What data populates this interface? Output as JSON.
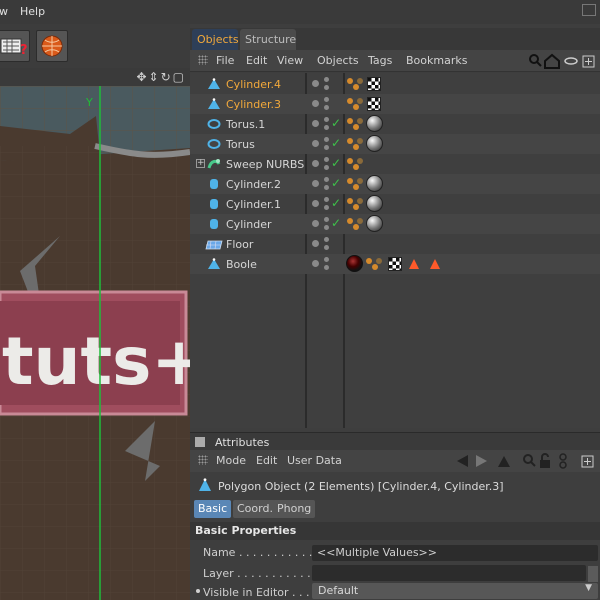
{
  "menubar": {
    "view_partial": "w",
    "help": "Help"
  },
  "objects_panel": {
    "tabs": [
      {
        "label": "Objects"
      },
      {
        "label": "Structure"
      }
    ],
    "menu": [
      "File",
      "Edit",
      "View",
      "Objects",
      "Tags",
      "Bookmarks"
    ],
    "objects": [
      {
        "name": "Cylinder.4",
        "selected": true,
        "icon": "polygon-object-icon"
      },
      {
        "name": "Cylinder.3",
        "selected": true,
        "icon": "polygon-object-icon"
      },
      {
        "name": "Torus.1",
        "icon": "torus-icon"
      },
      {
        "name": "Torus",
        "icon": "torus-icon"
      },
      {
        "name": "Sweep NURBS",
        "icon": "sweep-nurbs-icon"
      },
      {
        "name": "Cylinder.2",
        "icon": "cylinder-icon"
      },
      {
        "name": "Cylinder.1",
        "icon": "cylinder-icon"
      },
      {
        "name": "Cylinder",
        "icon": "cylinder-icon"
      },
      {
        "name": "Floor",
        "icon": "floor-icon"
      },
      {
        "name": "Boole",
        "icon": "boole-icon"
      }
    ]
  },
  "attributes": {
    "title": "Attributes",
    "menu": [
      "Mode",
      "Edit",
      "User Data"
    ],
    "object_title": "Polygon Object (2 Elements) [Cylinder.4, Cylinder.3]",
    "tabs": [
      "Basic",
      "Coord.",
      "Phong"
    ],
    "section": "Basic Properties",
    "props": {
      "name_label": "Name . . . . . . . . . . . .",
      "name_value": "<<Multiple Values>>",
      "layer_label": "Layer . . . . . . . . . . . .",
      "visible_label": "Visible in Editor . . . .",
      "visible_value": "Default"
    }
  },
  "viewport": {
    "axis_label": "Y",
    "logo_text": "tuts+"
  },
  "colors": {
    "selected_text": "#f2a93b",
    "active_tab_bg": "#2e3f58",
    "attr_tab_on": "#5a87b6",
    "check_green": "#3ec24a",
    "viewport_bg": "#4c4336"
  }
}
